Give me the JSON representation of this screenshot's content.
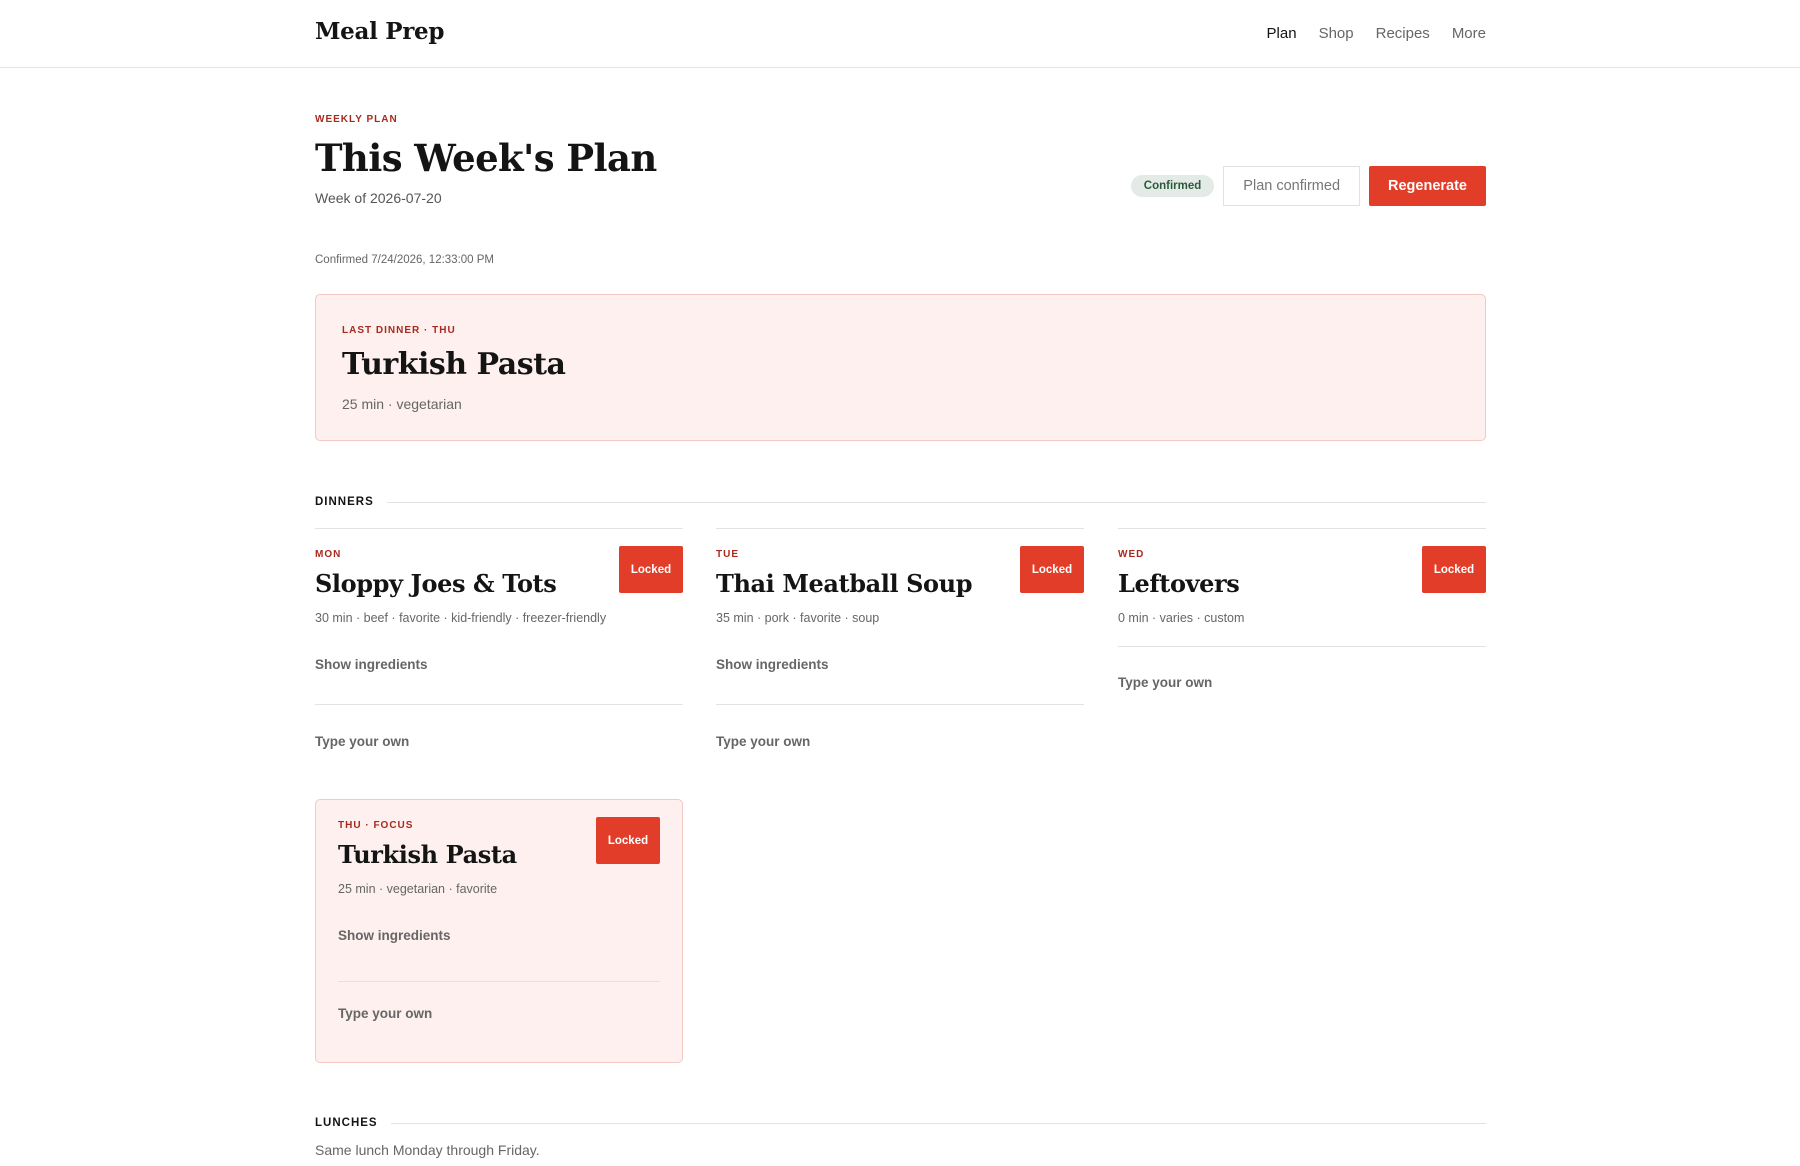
{
  "header": {
    "brand": "Meal Prep",
    "nav": [
      {
        "label": "Plan",
        "active": true
      },
      {
        "label": "Shop",
        "active": false
      },
      {
        "label": "Recipes",
        "active": false
      },
      {
        "label": "More",
        "active": false
      }
    ]
  },
  "page": {
    "eyebrow": "WEEKLY PLAN",
    "title": "This Week's Plan",
    "subtitle": "Week of 2026-07-20",
    "status_badge": "Confirmed",
    "plan_confirmed_button": "Plan confirmed",
    "regenerate_button": "Regenerate",
    "confirmed_timestamp": "Confirmed 7/24/2026, 12:33:00 PM"
  },
  "hero": {
    "eyebrow": "LAST DINNER · THU",
    "name": "Turkish Pasta",
    "meta": "25 min · vegetarian"
  },
  "dinners": {
    "section_label": "DINNERS",
    "cards": [
      {
        "day": "MON",
        "name": "Sloppy Joes & Tots",
        "meta": "30 min · beef · favorite · kid-friendly · freezer-friendly",
        "locked_label": "Locked",
        "show_ingredients": "Show ingredients",
        "type_own": "Type your own"
      },
      {
        "day": "TUE",
        "name": "Thai Meatball Soup",
        "meta": "35 min · pork · favorite · soup",
        "locked_label": "Locked",
        "show_ingredients": "Show ingredients",
        "type_own": "Type your own"
      },
      {
        "day": "WED",
        "name": "Leftovers",
        "meta": "0 min · varies · custom",
        "locked_label": "Locked",
        "type_own": "Type your own"
      },
      {
        "day": "THU · FOCUS",
        "name": "Turkish Pasta",
        "meta": "25 min · vegetarian · favorite",
        "locked_label": "Locked",
        "show_ingredients": "Show ingredients",
        "type_own": "Type your own"
      }
    ]
  },
  "lunches": {
    "section_label": "LUNCHES",
    "note": "Same lunch Monday through Friday."
  },
  "colors": {
    "accent": "#e23d28",
    "accent_text": "#a82a1e",
    "highlight_bg": "#fdf0ef",
    "badge_bg": "#e4ebe6"
  }
}
